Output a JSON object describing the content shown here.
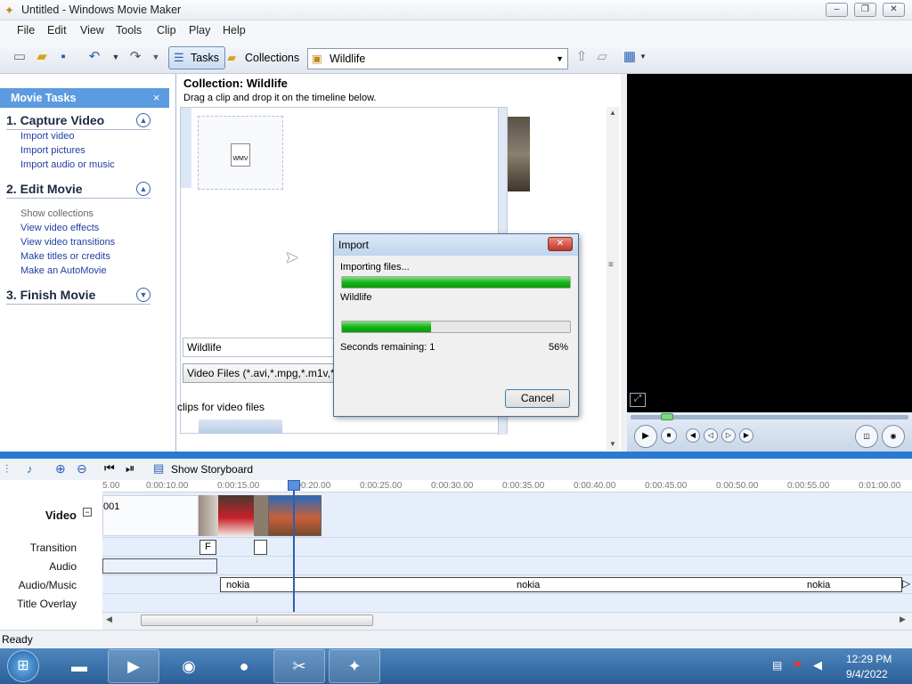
{
  "window": {
    "title": "Untitled - Windows Movie Maker"
  },
  "menu": [
    "File",
    "Edit",
    "View",
    "Tools",
    "Clip",
    "Play",
    "Help"
  ],
  "toolbar": {
    "tasks_label": "Tasks",
    "collections_label": "Collections",
    "collection_value": "Wildlife"
  },
  "movie_tasks": {
    "header": "Movie Tasks",
    "sections": [
      {
        "title": "1. Capture Video",
        "links": [
          "Import video",
          "Import pictures",
          "Import audio or music"
        ]
      },
      {
        "title": "2. Edit Movie",
        "links": [
          "Show collections",
          "View video effects",
          "View video transitions",
          "Make titles or credits",
          "Make an AutoMovie"
        ]
      },
      {
        "title": "3. Finish Movie",
        "links": []
      }
    ]
  },
  "collection": {
    "title": "Collection: Wildlife",
    "subtitle": "Drag a clip and drop it on the timeline below.",
    "thumb_label": "WMV",
    "file_name_value": "Wildlife",
    "file_type_value": "Video Files (*.avi,*.mpg,*.m1v,*.mp2",
    "clips_text": "clips for video files"
  },
  "import_dialog": {
    "title": "Import",
    "importing_label": "Importing files...",
    "overall_progress": 1.0,
    "file_label": "Wildlife",
    "file_progress": 0.39,
    "seconds_label": "Seconds remaining: 1",
    "percent": "56%",
    "cancel_label": "Cancel"
  },
  "timeline": {
    "storyboard_label": "Show Storyboard",
    "ruler": [
      "5.00",
      "0:00:10.00",
      "0:00:15.00",
      "0:00:20.00",
      "0:00:25.00",
      "0:00:30.00",
      "0:00:35.00",
      "0:00:40.00",
      "0:00:45.00",
      "0:00:50.00",
      "0:00:55.00",
      "0:01:00.00"
    ],
    "tracks": [
      "Video",
      "Transition",
      "Audio",
      "Audio/Music",
      "Title Overlay"
    ],
    "video_clip_text": "001",
    "transition_text": "F",
    "audio_clips": [
      "nokia",
      "nokia",
      "nokia"
    ]
  },
  "status": {
    "text": "Ready"
  },
  "taskbar": {
    "time": "12:29 PM",
    "date": "9/4/2022"
  }
}
